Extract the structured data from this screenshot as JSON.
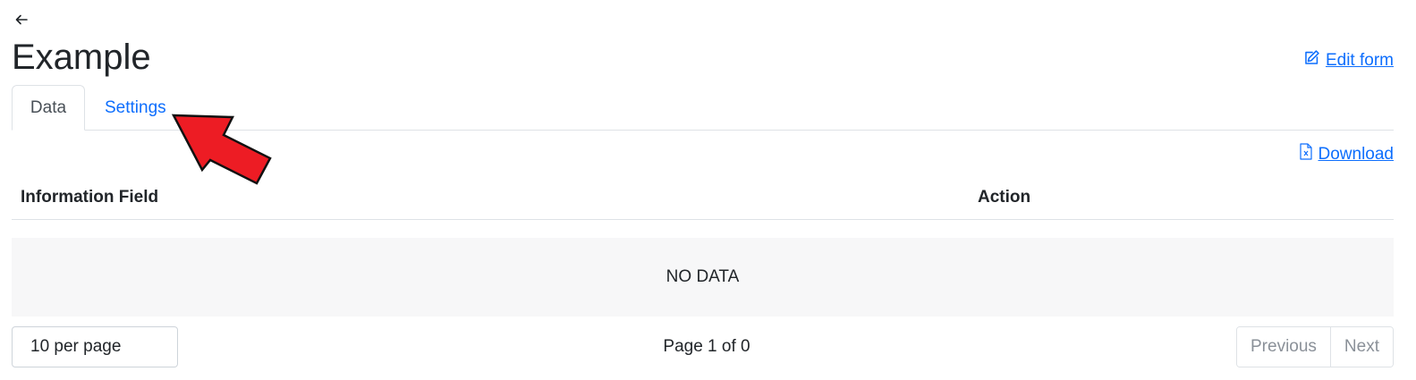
{
  "header": {
    "back_icon": "arrow-left-icon",
    "title": "Example",
    "edit_form": {
      "icon": "edit-icon",
      "label": "Edit form"
    }
  },
  "tabs": [
    {
      "label": "Data",
      "active": true
    },
    {
      "label": "Settings",
      "active": false
    }
  ],
  "download": {
    "icon": "file-excel-icon",
    "label": "Download"
  },
  "table": {
    "columns": [
      "Information Field",
      "Action"
    ],
    "empty_text": "NO DATA"
  },
  "pagination": {
    "per_page_label": "10 per page",
    "page_info": "Page 1 of 0",
    "previous_label": "Previous",
    "next_label": "Next"
  },
  "colors": {
    "link": "#0d6efd",
    "annotation_arrow": "#ed1c24"
  }
}
